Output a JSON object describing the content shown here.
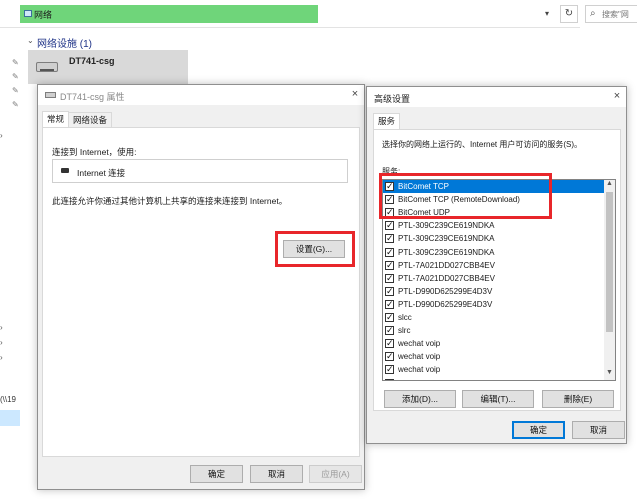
{
  "explorer": {
    "address": "网络",
    "search_placeholder": "搜索\"网",
    "group_title": "网络设施 (1)",
    "device_name": "DT741-csg",
    "nav_network": "(\\\\19",
    "icons": [
      "network-folder-icon",
      "dropdown-icon",
      "refresh-icon",
      "search-icon",
      "pin-icon",
      "device-icon"
    ]
  },
  "props_dialog": {
    "title": "DT741-csg 属性",
    "close": "×",
    "tabs": [
      "常规",
      "网络设备"
    ],
    "connect_label": "连接到 Internet，使用:",
    "connection_name": "Internet 连接",
    "share_text": "此连接允许你通过其他计算机上共享的连接来连接到 Internet。",
    "settings_button": "设置(G)...",
    "ok": "确定",
    "cancel": "取消",
    "apply": "应用(A)"
  },
  "adv_dialog": {
    "title": "高级设置",
    "close": "×",
    "tab": "服务",
    "instruction": "选择你的网络上运行的、Internet 用户可访问的服务(S)。",
    "services_label": "服务:",
    "services": [
      {
        "label": "BitComet TCP",
        "checked": true,
        "selected": true
      },
      {
        "label": "BitComet TCP (RemoteDownload)",
        "checked": true,
        "selected": false
      },
      {
        "label": "BitComet UDP",
        "checked": true,
        "selected": false
      },
      {
        "label": "PTL-309C239CE619NDKA",
        "checked": true,
        "selected": false
      },
      {
        "label": "PTL-309C239CE619NDKA",
        "checked": true,
        "selected": false
      },
      {
        "label": "PTL-309C239CE619NDKA",
        "checked": true,
        "selected": false
      },
      {
        "label": "PTL-7A021DD027CBB4EV",
        "checked": true,
        "selected": false
      },
      {
        "label": "PTL-7A021DD027CBB4EV",
        "checked": true,
        "selected": false
      },
      {
        "label": "PTL-D990D625299E4D3V",
        "checked": true,
        "selected": false
      },
      {
        "label": "PTL-D990D625299E4D3V",
        "checked": true,
        "selected": false
      },
      {
        "label": "slcc",
        "checked": true,
        "selected": false
      },
      {
        "label": "slrc",
        "checked": true,
        "selected": false
      },
      {
        "label": "wechat voip",
        "checked": true,
        "selected": false
      },
      {
        "label": "wechat voip",
        "checked": true,
        "selected": false
      },
      {
        "label": "wechat voip",
        "checked": true,
        "selected": false
      },
      {
        "label": "wechat voip",
        "checked": true,
        "selected": false
      }
    ],
    "add": "添加(D)...",
    "edit": "编辑(T)...",
    "delete": "删除(E)",
    "ok": "确定",
    "cancel": "取消"
  },
  "colors": {
    "address_highlight": "#6fd57a",
    "selection": "#0078d7",
    "annotation_red": "#e8262a",
    "group_title": "#1e3287"
  }
}
